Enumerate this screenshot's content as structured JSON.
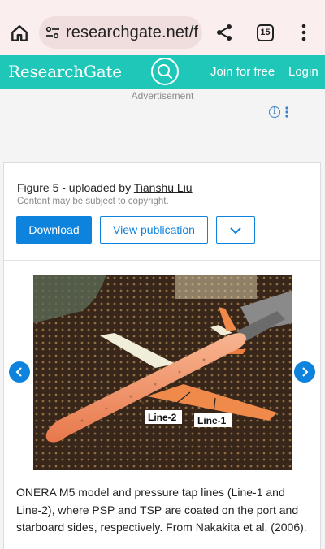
{
  "browser": {
    "url": "researchgate.net/f",
    "tab_count": "15",
    "icons": [
      "home-icon",
      "tune-icon",
      "share-icon",
      "tab-switcher-icon",
      "more-vert-icon"
    ]
  },
  "rg_header": {
    "logo": "ResearchGate",
    "join_label": "Join for free",
    "login_label": "Login",
    "color": "#1ec7b8"
  },
  "ad": {
    "label": "Advertisement",
    "info_glyph": "i"
  },
  "figure_card": {
    "title_prefix": "Figure 5 - uploaded by ",
    "author": "Tianshu Liu",
    "copyright": "Content may be subject to copyright.",
    "download_label": "Download",
    "view_label": "View publication",
    "accent": "#0d83dd",
    "image_labels": {
      "line2": "Line-2",
      "line1": "Line-1"
    },
    "caption": "ONERA M5 model and pressure tap lines (Line-1 and Line-2), where PSP and TSP are coated on the port and starboard sides, respectively. From Nakakita et al. (2006)."
  }
}
